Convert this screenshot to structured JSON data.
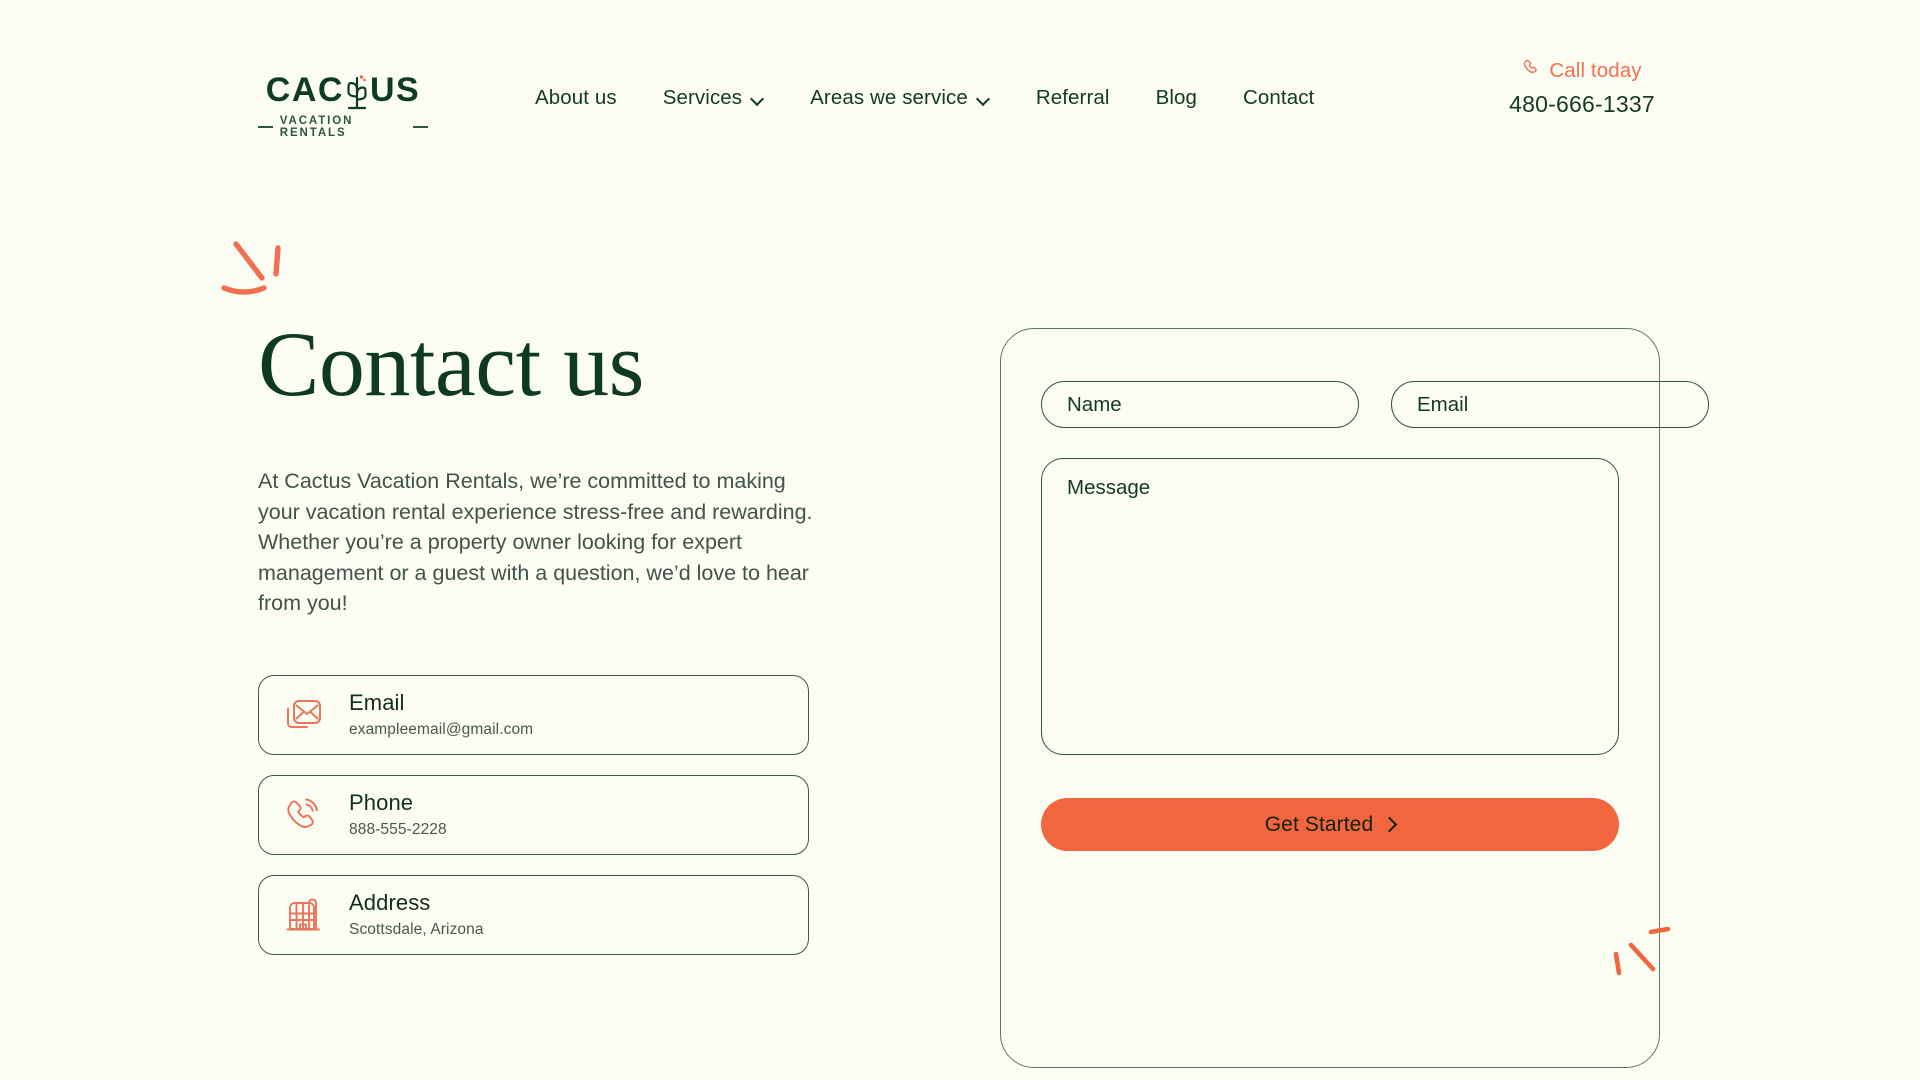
{
  "theme": {
    "background": "#FCFDF2",
    "green_dark": "#0E3A23",
    "green_text": "#123A26",
    "body_gray": "#40544A",
    "accent_orange": "#F2663F",
    "accent_orange_light": "#F27052",
    "border_green": "#3C5A48"
  },
  "header": {
    "logo": {
      "word_left": "CAC",
      "word_right": "US",
      "icon": "cactus-icon",
      "tagline": "VACATION RENTALS"
    },
    "nav": [
      {
        "label": "About us",
        "has_dropdown": false
      },
      {
        "label": "Services",
        "has_dropdown": true
      },
      {
        "label": "Areas we service",
        "has_dropdown": true
      },
      {
        "label": "Referral",
        "has_dropdown": false
      },
      {
        "label": "Blog",
        "has_dropdown": false
      },
      {
        "label": "Contact",
        "has_dropdown": false
      }
    ],
    "call": {
      "label": "Call today",
      "icon": "phone-icon",
      "number": "480-666-1337"
    }
  },
  "main": {
    "title": "Contact us",
    "lede": "At Cactus Vacation Rentals, we’re committed to making your vacation rental experience stress-free and rewarding. Whether you’re a property owner looking for expert management or a guest with a question, we’d love to hear from you!",
    "contact_cards": [
      {
        "icon": "envelope-icon",
        "title": "Email",
        "value": "exampleemail@gmail.com"
      },
      {
        "icon": "phone-ring-icon",
        "title": "Phone",
        "value": "888-555-2228"
      },
      {
        "icon": "building-icon",
        "title": "Address",
        "value": "Scottsdale, Arizona"
      }
    ]
  },
  "form": {
    "name_placeholder": "Name",
    "email_placeholder": "Email",
    "message_placeholder": "Message",
    "name_value": "",
    "email_value": "",
    "message_value": "",
    "submit_label": "Get Started"
  },
  "decorations": {
    "top_sparkle": "sparkle-mark",
    "button_sparkle": "sparkle-mark"
  }
}
